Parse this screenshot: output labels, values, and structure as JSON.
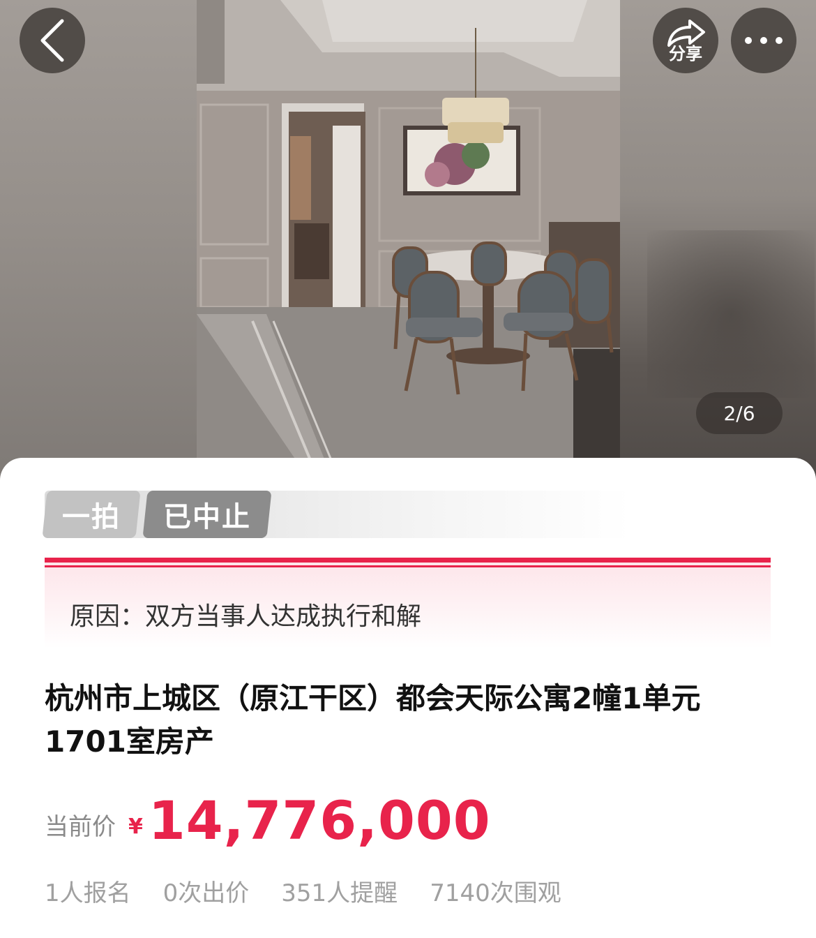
{
  "header": {
    "back_icon": "chevron-left-icon",
    "share_icon": "share-arrow-icon",
    "share_label": "分享",
    "more_icon": "more-dots-icon"
  },
  "gallery": {
    "counter": "2/6"
  },
  "tags": {
    "round": "一拍",
    "status": "已中止"
  },
  "reason": {
    "text": "原因：双方当事人达成执行和解"
  },
  "listing": {
    "title": "杭州市上城区（原江干区）都会天际公寓2幢1单元1701室房产",
    "price_label": "当前价",
    "currency": "¥",
    "price": "14,776,000"
  },
  "stats": {
    "signups": "1人报名",
    "bids": "0次出价",
    "reminders": "351人提醒",
    "views": "7140次围观"
  },
  "colors": {
    "accent": "#e8234b",
    "tag_round_bg": "#c2c2c2",
    "tag_status_bg": "#8c8c8c"
  }
}
